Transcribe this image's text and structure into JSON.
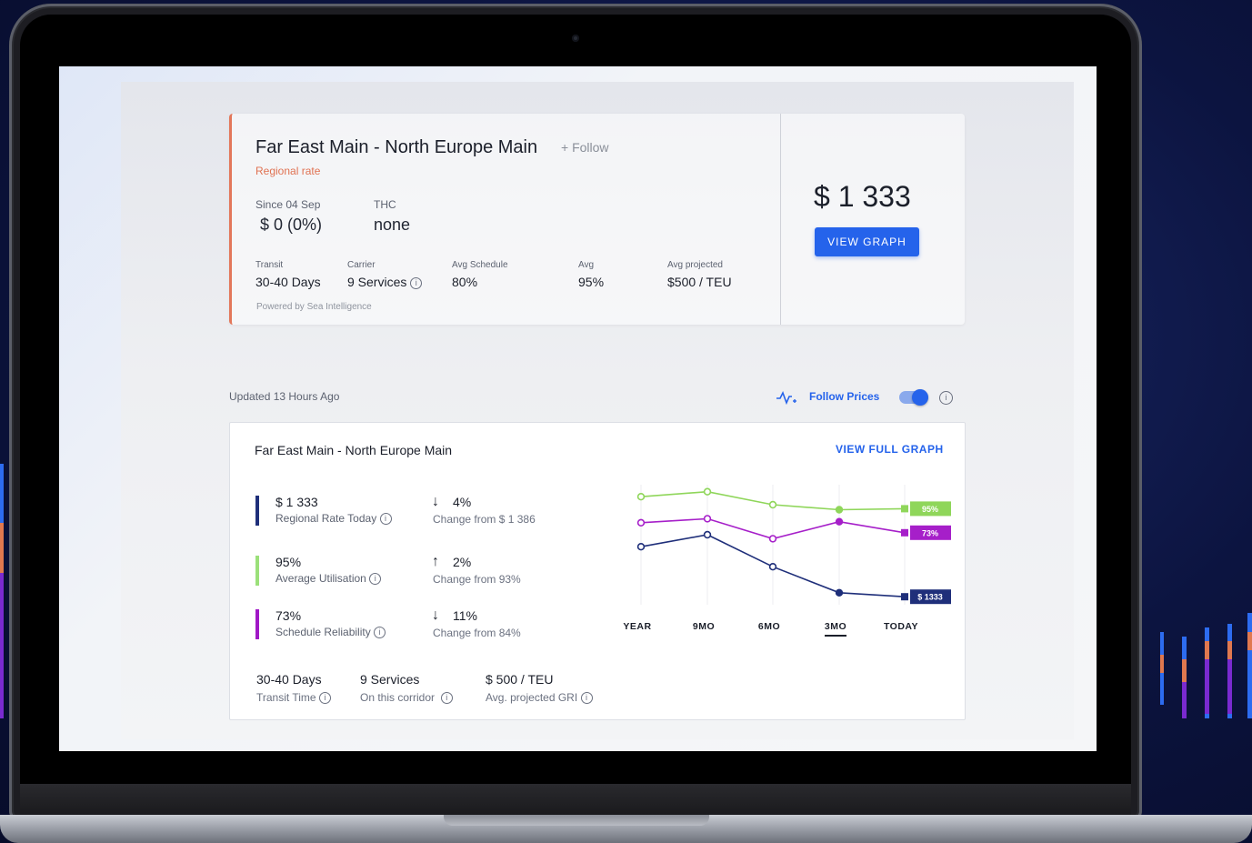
{
  "rate_card": {
    "title": "Far East Main - North Europe Main",
    "follow": "+ Follow",
    "tag": "Regional rate",
    "since_label": "Since 04 Sep",
    "since_value": "$ 0 (0%)",
    "thc_label": "THC",
    "thc_value": "none",
    "transit_label": "Transit",
    "transit_value": "30-40 Days",
    "carrier_label": "Carrier",
    "carrier_value": "9 Services",
    "avg_schedule_label": "Avg Schedule",
    "avg_schedule_value": "80%",
    "avg_label": "Avg",
    "avg_value": "95%",
    "avg_projected_label": "Avg projected",
    "avg_projected_value": "$500 / TEU",
    "powered_by": "Powered by Sea Intelligence",
    "price": "$ 1 333",
    "view_graph": "VIEW GRAPH"
  },
  "follow_row": {
    "updated": "Updated 13 Hours Ago",
    "follow_prices": "Follow Prices",
    "toggle_on": true
  },
  "trend_card": {
    "title": "Far East Main - North Europe Main",
    "view_full_graph": "VIEW FULL GRAPH",
    "metrics": [
      {
        "value": "$ 1 333",
        "label": "Regional Rate Today",
        "arrow": "↓",
        "change": "4%",
        "change_label": "Change from $ 1 386",
        "color": "#1f2f7a"
      },
      {
        "value": "95%",
        "label": "Average Utilisation",
        "arrow": "↑",
        "change": "2%",
        "change_label": "Change from 93%",
        "color": "#9be07a"
      },
      {
        "value": "73%",
        "label": "Schedule Reliability",
        "arrow": "↓",
        "change": "11%",
        "change_label": "Change from 84%",
        "color": "#a018c6"
      }
    ],
    "summary": [
      {
        "value": "30-40 Days",
        "label": "Transit Time"
      },
      {
        "value": "9 Services",
        "label": "On this corridor"
      },
      {
        "value": "$ 500 / TEU",
        "label": "Avg. projected GRI"
      }
    ]
  },
  "chart_data": {
    "type": "line",
    "categories": [
      "YEAR",
      "9MO",
      "6MO",
      "3MO",
      "TODAY"
    ],
    "selected_category": "3MO",
    "series": [
      {
        "label": "95%",
        "color": "#8fd65a",
        "values": [
          88,
          93,
          80,
          75,
          76
        ]
      },
      {
        "label": "73%",
        "color": "#a61fc9",
        "values": [
          62,
          66,
          46,
          63,
          52
        ]
      },
      {
        "label": "$ 1333",
        "color": "#1f2f7a",
        "values": [
          38,
          50,
          18,
          -8,
          -12
        ]
      }
    ],
    "ylim": [
      -20,
      100
    ],
    "grid": "vertical"
  }
}
